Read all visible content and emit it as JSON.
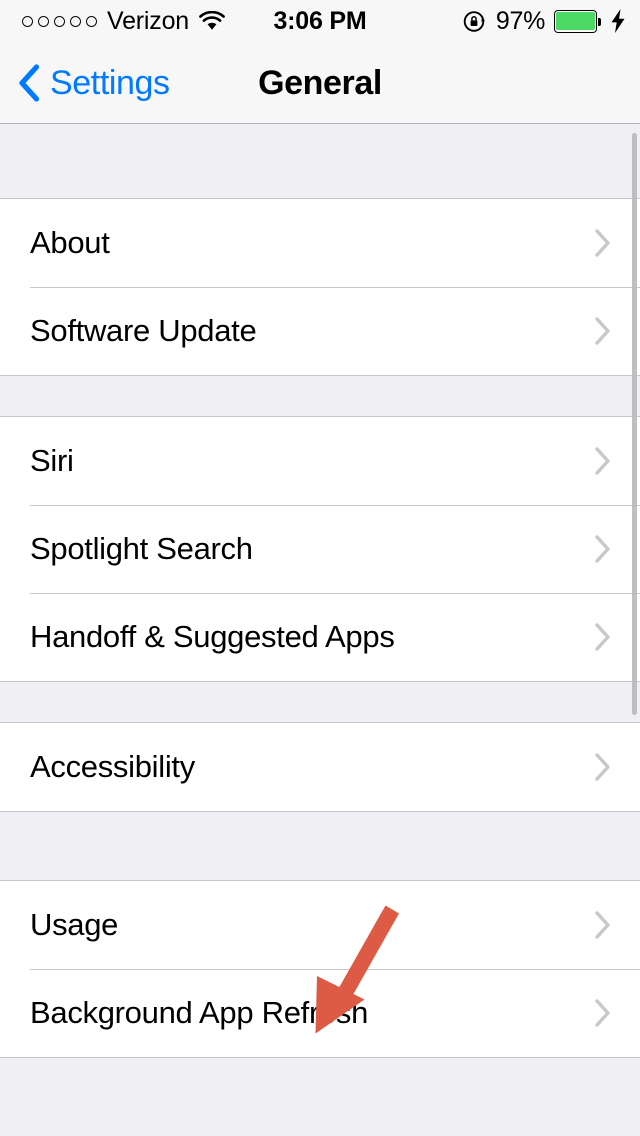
{
  "status_bar": {
    "signal_icon": "no-service-dots",
    "signal_dots": 5,
    "carrier": "Verizon",
    "wifi_icon": "wifi-icon",
    "time": "3:06 PM",
    "rotation_lock_icon": "rotation-lock-icon",
    "battery_percent": "97%",
    "battery_level": 97,
    "battery_color": "#4CD964",
    "charging_icon": "lightning-bolt-icon",
    "is_charging": true
  },
  "nav_bar": {
    "back_icon": "chevron-left-icon",
    "back_label": "Settings",
    "title": "General",
    "tint_color": "#007AFF"
  },
  "settings": {
    "disclosure_icon": "chevron-right-icon",
    "groups": [
      {
        "rows": [
          {
            "label": "About"
          },
          {
            "label": "Software Update"
          }
        ]
      },
      {
        "rows": [
          {
            "label": "Siri"
          },
          {
            "label": "Spotlight Search"
          },
          {
            "label": "Handoff & Suggested Apps"
          }
        ]
      },
      {
        "rows": [
          {
            "label": "Accessibility"
          }
        ]
      },
      {
        "rows": [
          {
            "label": "Usage"
          },
          {
            "label": "Background App Refresh"
          }
        ]
      }
    ]
  },
  "annotation": {
    "arrow_icon": "red-arrow-annotation",
    "color": "#DD5A44",
    "points_at": "Background App Refresh"
  },
  "scrollbar": {
    "visible": true,
    "color": "#B9B9BE"
  }
}
